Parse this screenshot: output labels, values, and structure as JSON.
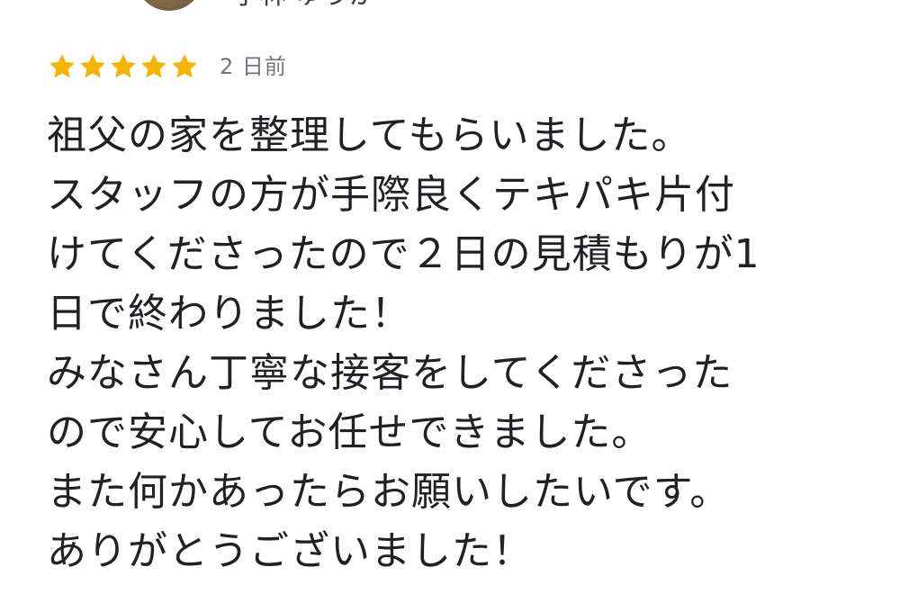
{
  "reviewer": {
    "name": "小林 ゆうか",
    "avatar_icon": "avatar-photo-icon"
  },
  "rating": {
    "stars": 5,
    "max": 5,
    "star_color": "#F4B400",
    "star_icon": "star-icon",
    "time_ago": "2 日前"
  },
  "review": {
    "lines": [
      "祖父の家を整理してもらいました。",
      "スタッフの方が手際良くテキパキ片付",
      "けてくださったので２日の見積もりが1",
      "日で終わりました！",
      "みなさん丁寧な接客をしてくださった",
      "ので安心してお任せできました。",
      "また何かあったらお願いしたいです。",
      "ありがとうございました！"
    ]
  }
}
